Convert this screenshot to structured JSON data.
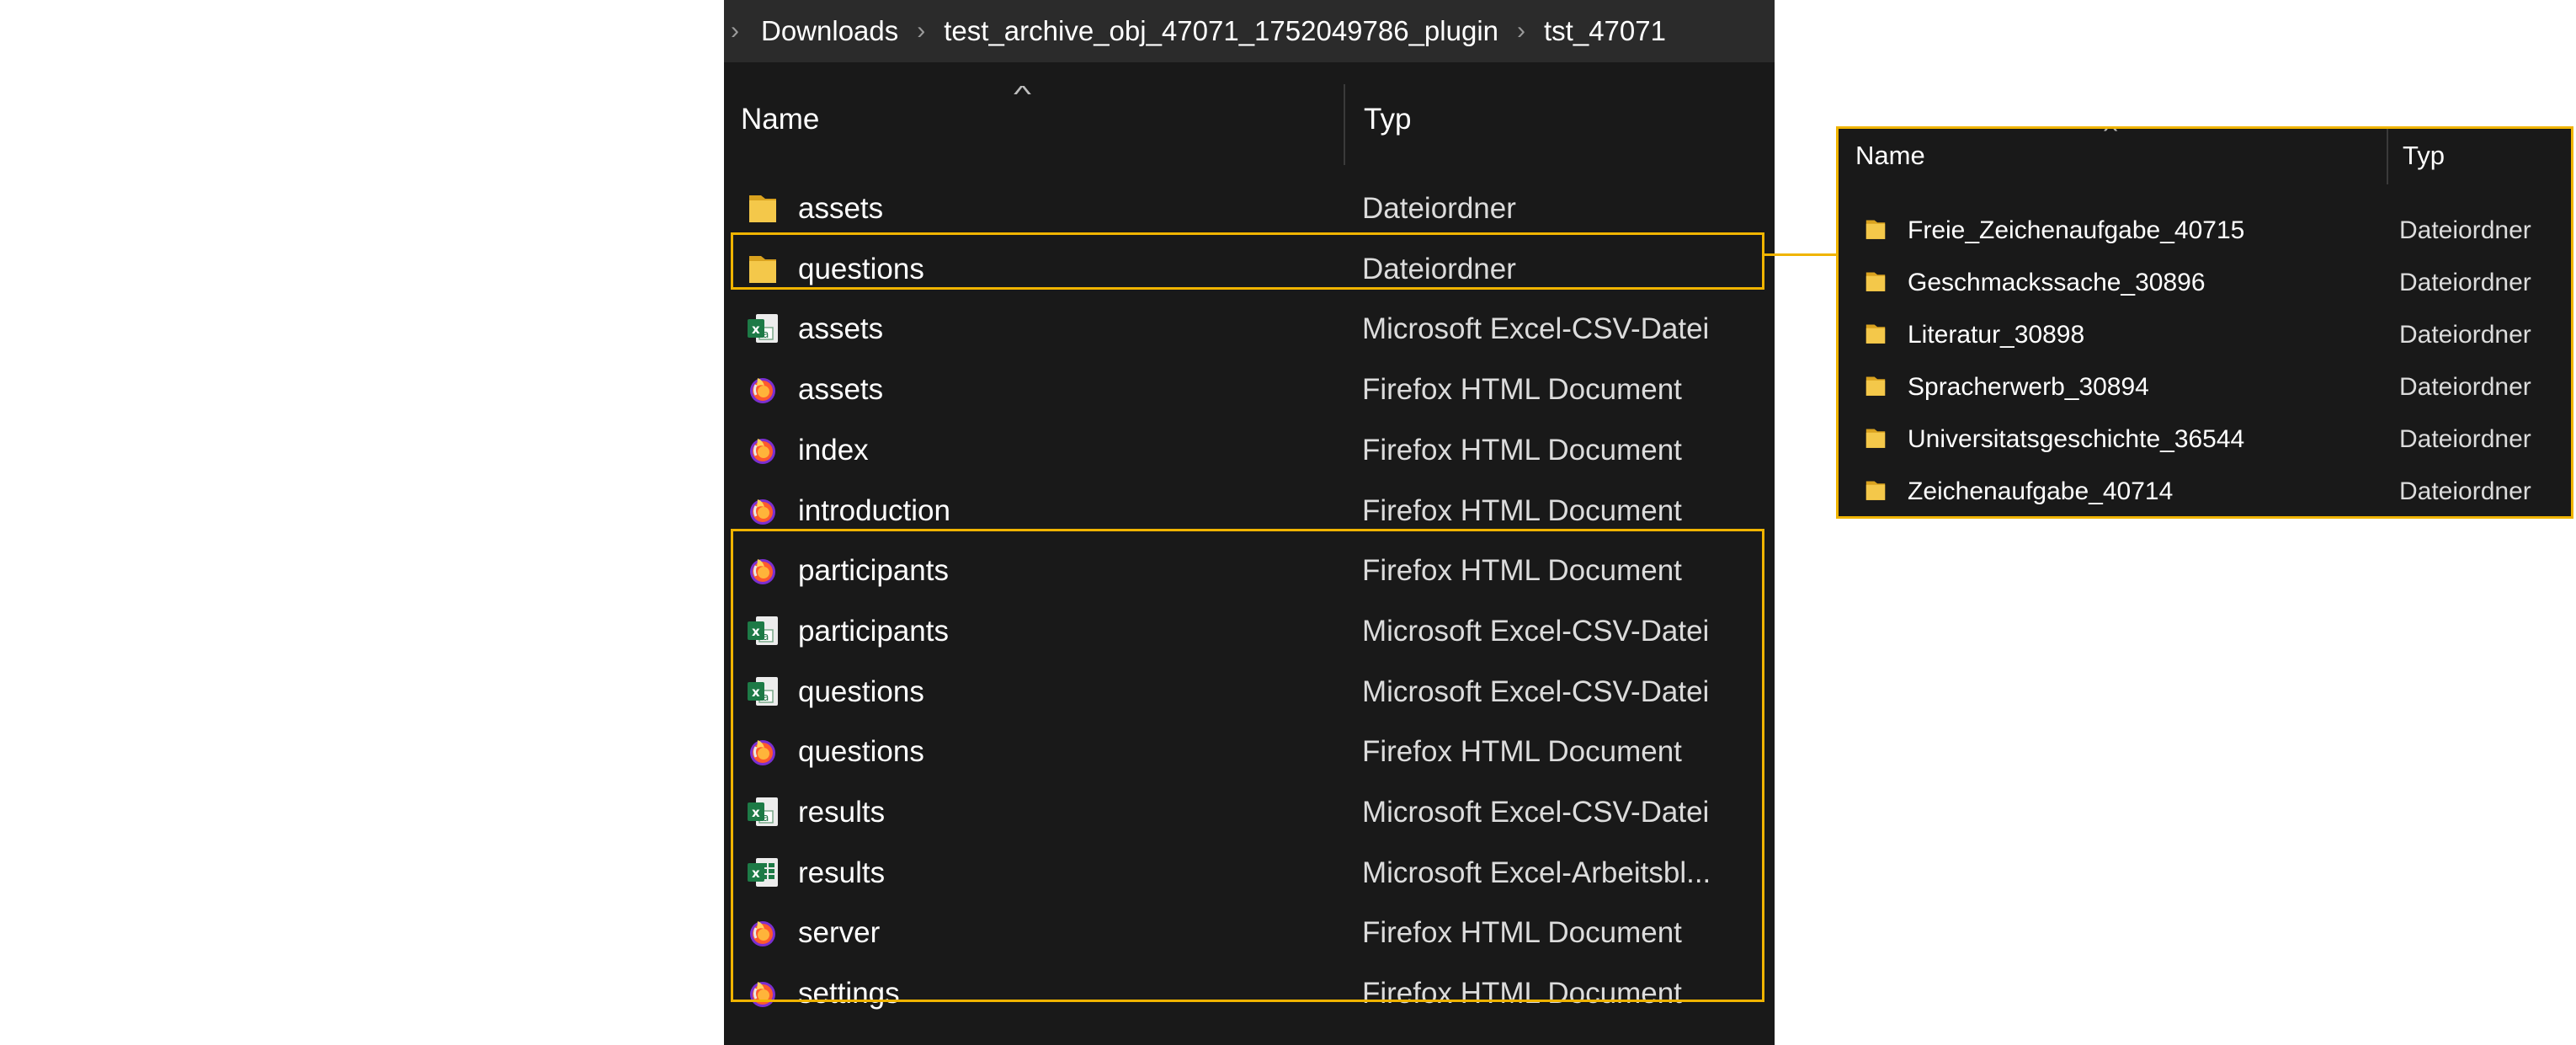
{
  "breadcrumb": [
    "Downloads",
    "test_archive_obj_47071_1752049786_plugin",
    "tst_47071"
  ],
  "columns": {
    "name": "Name",
    "type": "Typ"
  },
  "files": [
    {
      "name": "assets",
      "type": "Dateiordner",
      "icon": "folder-icon"
    },
    {
      "name": "questions",
      "type": "Dateiordner",
      "icon": "folder-icon"
    },
    {
      "name": "assets",
      "type": "Microsoft Excel-CSV-Datei",
      "icon": "excel-csv-icon"
    },
    {
      "name": "assets",
      "type": "Firefox HTML Document",
      "icon": "firefox-icon"
    },
    {
      "name": "index",
      "type": "Firefox HTML Document",
      "icon": "firefox-icon"
    },
    {
      "name": "introduction",
      "type": "Firefox HTML Document",
      "icon": "firefox-icon"
    },
    {
      "name": "participants",
      "type": "Firefox HTML Document",
      "icon": "firefox-icon"
    },
    {
      "name": "participants",
      "type": "Microsoft Excel-CSV-Datei",
      "icon": "excel-csv-icon"
    },
    {
      "name": "questions",
      "type": "Microsoft Excel-CSV-Datei",
      "icon": "excel-csv-icon"
    },
    {
      "name": "questions",
      "type": "Firefox HTML Document",
      "icon": "firefox-icon"
    },
    {
      "name": "results",
      "type": "Microsoft Excel-CSV-Datei",
      "icon": "excel-csv-icon"
    },
    {
      "name": "results",
      "type": "Microsoft Excel-Arbeitsbl...",
      "icon": "excel-worksheet-icon"
    },
    {
      "name": "server",
      "type": "Firefox HTML Document",
      "icon": "firefox-icon"
    },
    {
      "name": "settings",
      "type": "Firefox HTML Document",
      "icon": "firefox-icon"
    }
  ],
  "subfolder": {
    "columns": {
      "name": "Name",
      "type": "Typ"
    },
    "items": [
      {
        "name": "Freie_Zeichenaufgabe_40715",
        "type": "Dateiordner",
        "icon": "folder-icon"
      },
      {
        "name": "Geschmackssache_30896",
        "type": "Dateiordner",
        "icon": "folder-icon"
      },
      {
        "name": "Literatur_30898",
        "type": "Dateiordner",
        "icon": "folder-icon"
      },
      {
        "name": "Spracherwerb_30894",
        "type": "Dateiordner",
        "icon": "folder-icon"
      },
      {
        "name": "Universitatsgeschichte_36544",
        "type": "Dateiordner",
        "icon": "folder-icon"
      },
      {
        "name": "Zeichenaufgabe_40714",
        "type": "Dateiordner",
        "icon": "folder-icon"
      }
    ]
  },
  "colors": {
    "highlight": "#f0b400",
    "background": "#191919",
    "breadcrumb_bg": "#2b2b2b"
  }
}
